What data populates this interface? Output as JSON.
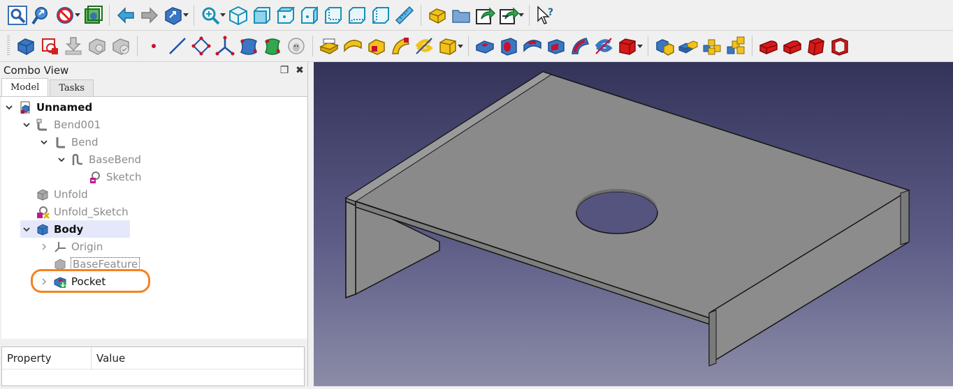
{
  "toolbar_row1": {
    "groups": [
      [
        "fit-all-icon",
        "fit-selection-icon",
        "draw-style-icon",
        "bounding-box-icon"
      ],
      [
        "back-arrow-icon",
        "forward-arrow-icon",
        "workbench-selector-icon"
      ],
      [
        "zoom-icon",
        "isometric-view-icon",
        "front-view-icon",
        "top-view-icon",
        "right-view-icon",
        "rear-view-icon",
        "bottom-view-icon",
        "left-view-icon",
        "measure-icon"
      ],
      [
        "part-icon",
        "group-folder-icon",
        "link-icon",
        "link-actions-icon"
      ],
      [
        "whats-this-icon"
      ]
    ]
  },
  "toolbar_row2": {
    "groups": [
      [
        "body-icon",
        "create-sketch-icon",
        "validate-sketch-icon",
        "shape-binder-icon",
        "clone-icon"
      ],
      [
        "datum-point-icon",
        "datum-line-icon",
        "datum-plane-icon",
        "local-cs-icon",
        "shape-binder-blue-icon",
        "subshape-binder-icon",
        "sheep-icon"
      ],
      [
        "pad-icon",
        "revolution-icon",
        "additive-loft-icon",
        "additive-pipe-icon",
        "additive-helix-icon",
        "additive-primitive-icon"
      ],
      [
        "pocket-icon",
        "hole-icon",
        "groove-icon",
        "subtractive-loft-icon",
        "subtractive-pipe-icon",
        "subtractive-helix-icon",
        "subtractive-primitive-icon"
      ],
      [
        "mirrored-icon",
        "linear-pattern-icon",
        "polar-pattern-icon",
        "multitransform-icon"
      ],
      [
        "fillet-icon",
        "chamfer-icon",
        "draft-icon",
        "thickness-icon"
      ]
    ]
  },
  "combo_view": {
    "title": "Combo View",
    "tabs": [
      "Model",
      "Tasks"
    ],
    "tree": [
      {
        "label": "Unnamed",
        "depth": 0,
        "expanded": true,
        "icon": "document-icon",
        "style": "bold"
      },
      {
        "label": "Bend001",
        "depth": 1,
        "expanded": true,
        "icon": "sheetmetal-bend-icon",
        "style": "grey"
      },
      {
        "label": "Bend",
        "depth": 2,
        "expanded": true,
        "icon": "sheetmetal-wall-icon",
        "style": "grey"
      },
      {
        "label": "BaseBend",
        "depth": 3,
        "expanded": true,
        "icon": "sheetmetal-base-icon",
        "style": "grey"
      },
      {
        "label": "Sketch",
        "depth": 4,
        "expanded": null,
        "icon": "sketch-icon",
        "style": "grey"
      },
      {
        "label": "Unfold",
        "depth": 1,
        "expanded": null,
        "icon": "unfold-icon",
        "style": "grey"
      },
      {
        "label": "Unfold_Sketch",
        "depth": 1,
        "expanded": null,
        "icon": "unfold-sketch-icon",
        "style": "grey"
      },
      {
        "label": "Body",
        "depth": 1,
        "expanded": true,
        "icon": "body-icon",
        "style": "bold-selected"
      },
      {
        "label": "Origin",
        "depth": 2,
        "expanded": false,
        "icon": "origin-icon",
        "style": "grey"
      },
      {
        "label": "BaseFeature",
        "depth": 2,
        "expanded": null,
        "icon": "basefeature-icon",
        "style": "grey-dotted"
      },
      {
        "label": "Pocket",
        "depth": 2,
        "expanded": false,
        "icon": "pocket-feature-icon",
        "style": "dark"
      }
    ]
  },
  "property_view": {
    "col_property": "Property",
    "col_value": "Value"
  },
  "colors": {
    "highlight_ring": "#f58220",
    "viewport_top": "#33335a",
    "viewport_bottom": "#8c8ca8",
    "part_face": "#8a8a8a"
  }
}
